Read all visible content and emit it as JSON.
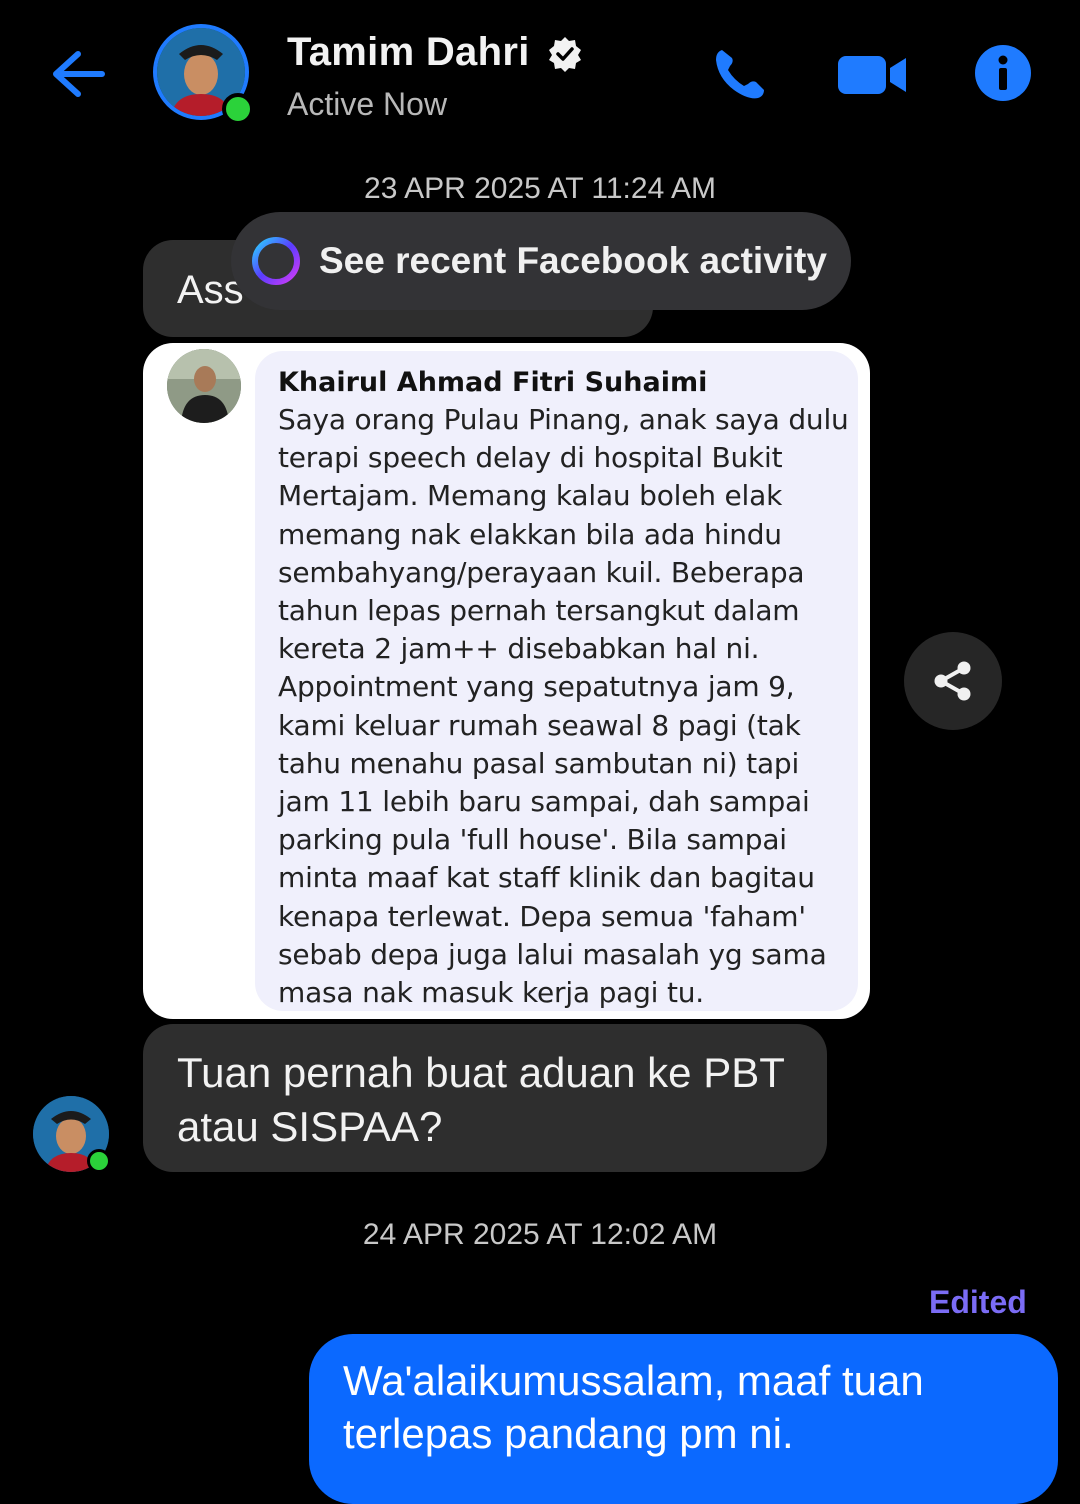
{
  "header": {
    "contact_name": "Tamim Dahri",
    "status": "Active Now",
    "back_icon": "arrow-left-icon",
    "call_icon": "phone-icon",
    "video_icon": "video-camera-icon",
    "info_icon": "info-icon",
    "verified_icon": "verified-badge-icon",
    "accent_color": "#1f7bff"
  },
  "thread": {
    "timestamp_1": "23 APR 2025 AT 11:24 AM",
    "first_message_visible": "Ass",
    "fb_activity_label": "See recent Facebook activity",
    "shared_comment": {
      "author": "Khairul Ahmad Fitri Suhaimi",
      "lines": [
        "Saya orang Pulau Pinang, anak saya dulu",
        "terapi speech delay di hospital Bukit",
        "Mertajam. Memang kalau boleh elak",
        "memang nak elakkan bila ada hindu",
        "sembahyang/perayaan kuil. Beberapa",
        "tahun lepas pernah tersangkut dalam",
        "kereta 2 jam++ disebabkan hal ni.",
        "Appointment yang sepatutnya jam 9,",
        "kami keluar rumah seawal 8 pagi (tak",
        "tahu menahu pasal sambutan ni) tapi",
        "jam 11 lebih baru sampai, dah sampai",
        "parking pula 'full house'. Bila sampai",
        "minta maaf kat staff klinik dan bagitau",
        "kenapa terlewat. Depa semua 'faham'",
        "sebab depa juga lalui masalah yg sama",
        "masa nak masuk kerja pagi tu."
      ]
    },
    "reply_line_1": "Tuan pernah buat aduan ke PBT",
    "reply_line_2": "atau SISPAA?",
    "timestamp_2": "24 APR 2025 AT 12:02 AM",
    "edited_label": "Edited",
    "my_line_1": "Wa'alaikumussalam, maaf tuan",
    "my_line_2": "terlepas pandang pm ni.",
    "my_bubble_color": "#0b69ff"
  }
}
